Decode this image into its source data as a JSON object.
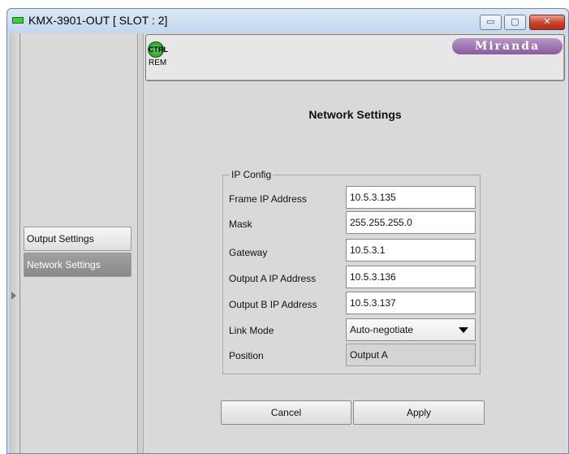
{
  "window": {
    "title": "KMX-3901-OUT [ SLOT : 2]",
    "controls": {
      "minimize": "▭",
      "maximize": "▢",
      "close": "✕"
    }
  },
  "sidebar": {
    "items": [
      {
        "label": "Output Settings",
        "active": false
      },
      {
        "label": "Network Settings",
        "active": true
      }
    ]
  },
  "toolbar": {
    "ctrl_badge": "CTRL",
    "rem_label": "REM",
    "logo_text": "Miranda"
  },
  "panel": {
    "title": "Network Settings",
    "group_label": "IP Config",
    "fields": [
      {
        "label": "Frame IP Address",
        "value": "10.5.3.135",
        "type": "text"
      },
      {
        "label": "Mask",
        "value": "255.255.255.0",
        "type": "text"
      },
      {
        "label": "Gateway",
        "value": "10.5.3.1",
        "type": "text"
      },
      {
        "label": "Output A IP Address",
        "value": "10.5.3.136",
        "type": "text"
      },
      {
        "label": "Output B IP Address",
        "value": "10.5.3.137",
        "type": "text"
      },
      {
        "label": "Link Mode",
        "value": "Auto-negotiate",
        "type": "select"
      },
      {
        "label": "Position",
        "value": "Output A",
        "type": "readonly"
      }
    ]
  },
  "buttons": {
    "cancel": "Cancel",
    "apply": "Apply"
  },
  "colors": {
    "title_bar": "#c3d6ec",
    "panel_bg": "#d9d9d9",
    "active_sidebar": "#8a8a8a",
    "close_button": "#c6422a",
    "status_green": "#3ad13a",
    "logo": "#8a5aa0"
  }
}
